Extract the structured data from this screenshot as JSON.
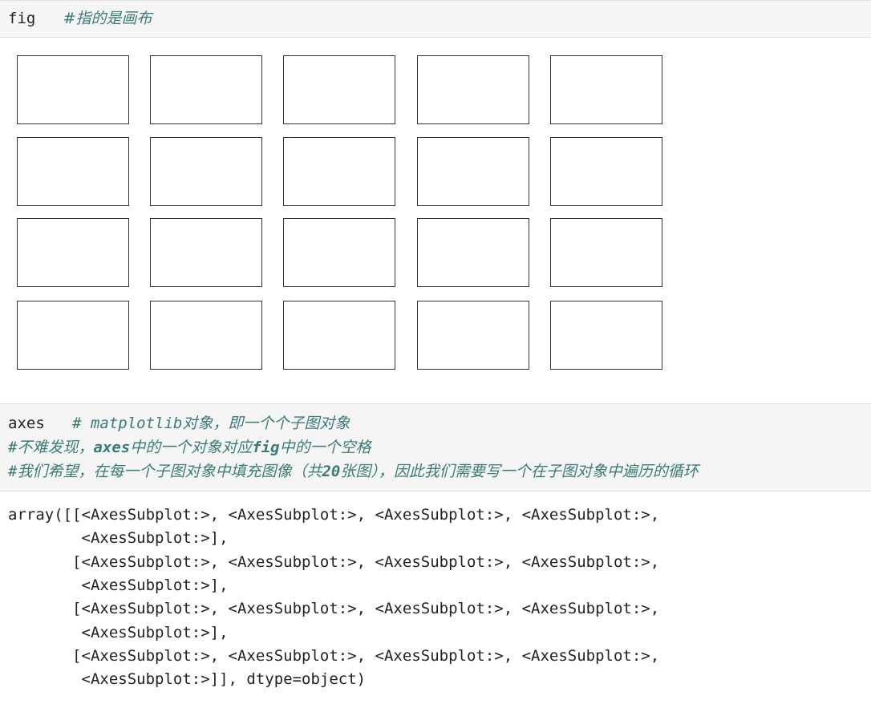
{
  "cells": [
    {
      "lines": [
        {
          "code": "fig   ",
          "comment": "#指的是画布"
        }
      ]
    },
    {
      "lines": [
        {
          "code": "axes   ",
          "comment_parts": [
            "# matplotlib",
            "对象，即一个个子图对象"
          ]
        },
        {
          "code": "",
          "comment_parts": [
            "#",
            "不难发现，",
            "axes",
            "中的一个对象对应",
            "fig",
            "中的一个空格"
          ]
        },
        {
          "code": "",
          "comment_parts": [
            "#",
            "我们希望，在每一个子图对象中填充图像（共",
            "20",
            "张图），因此我们需要写一个在子图对象中遍历的循环"
          ]
        }
      ]
    }
  ],
  "figure": {
    "rows": 4,
    "cols": 5
  },
  "output": {
    "lines": [
      "array([[<AxesSubplot:>, <AxesSubplot:>, <AxesSubplot:>, <AxesSubplot:>,",
      "        <AxesSubplot:>],",
      "       [<AxesSubplot:>, <AxesSubplot:>, <AxesSubplot:>, <AxesSubplot:>,",
      "        <AxesSubplot:>],",
      "       [<AxesSubplot:>, <AxesSubplot:>, <AxesSubplot:>, <AxesSubplot:>,",
      "        <AxesSubplot:>],",
      "       [<AxesSubplot:>, <AxesSubplot:>, <AxesSubplot:>, <AxesSubplot:>,",
      "        <AxesSubplot:>]], dtype=object)"
    ]
  }
}
